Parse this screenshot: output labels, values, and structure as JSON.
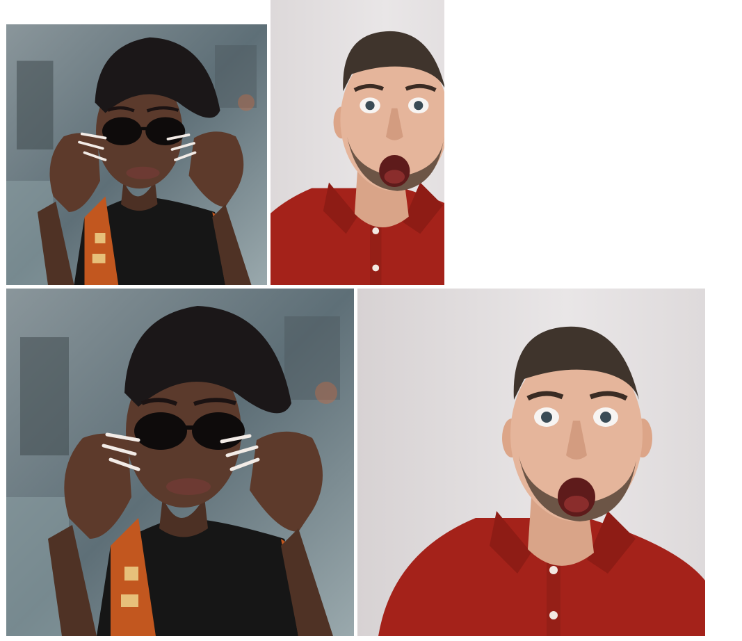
{
  "gallery": {
    "photos": [
      {
        "subject": "woman-with-sunglasses",
        "variant": "small-square"
      },
      {
        "subject": "surprised-man-red-shirt",
        "variant": "small-portrait"
      },
      {
        "subject": "woman-with-sunglasses",
        "variant": "large-square"
      },
      {
        "subject": "surprised-man-red-shirt",
        "variant": "large-square"
      }
    ]
  },
  "colors": {
    "page_background": "#ffffff",
    "street_blur": "#6f8088",
    "skin_dark": "#5b3a2c",
    "beret": "#1b1718",
    "sunglasses": "#0e0b0b",
    "black_top": "#161616",
    "pattern_orange": "#c2571f",
    "wall": "#e3dfe0",
    "skin_light": "#e5b59b",
    "hair_brown": "#3f342c",
    "beard": "#6c5546",
    "red_shirt": "#a4221a",
    "nails": "#f3ece7"
  }
}
